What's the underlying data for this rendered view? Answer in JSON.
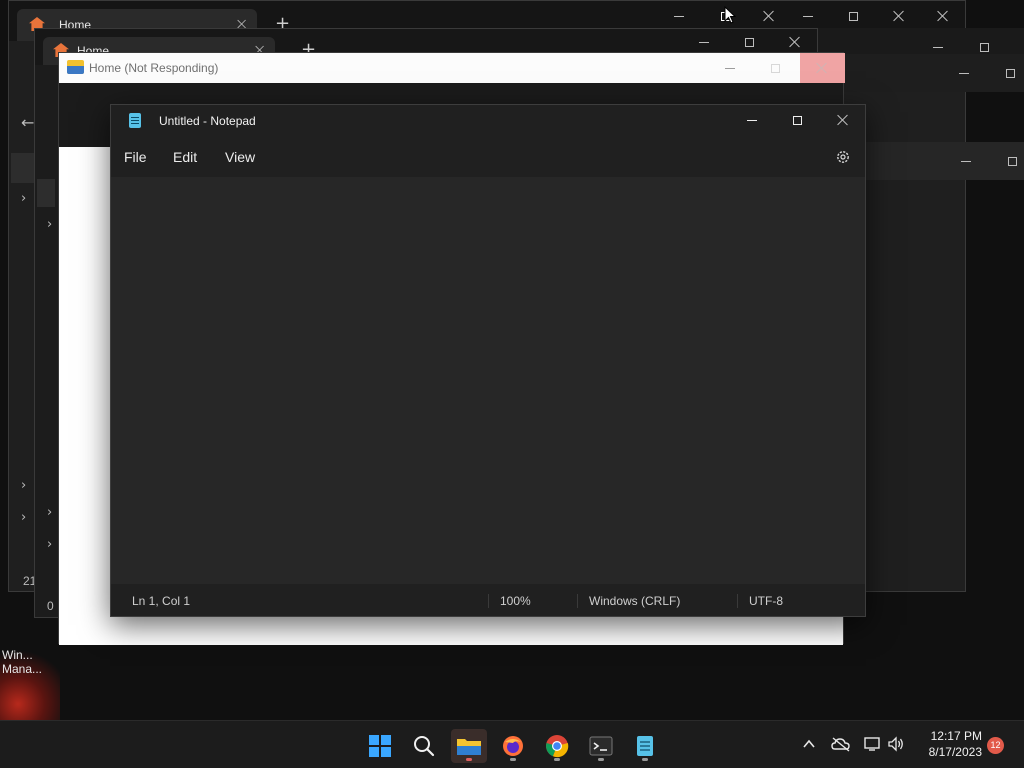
{
  "background_windows": {
    "explorer_back_tab": "Home",
    "explorer_mid_tab": "Home",
    "explorer_front_title": "Home (Not Responding)",
    "left_stub_1": "21",
    "left_stub_2": "0",
    "desktop_icon_label": "Win... Mana..."
  },
  "notepad": {
    "title": "Untitled - Notepad",
    "menu": {
      "file": "File",
      "edit": "Edit",
      "view": "View"
    },
    "content": "",
    "status": {
      "position": "Ln 1, Col 1",
      "zoom": "100%",
      "line_ending": "Windows (CRLF)",
      "encoding": "UTF-8"
    }
  },
  "taskbar": {
    "time": "12:17 PM",
    "date": "8/17/2023",
    "notification_count": "12"
  },
  "colors": {
    "close_hover": "#e81123",
    "accent": "#0067c0"
  }
}
